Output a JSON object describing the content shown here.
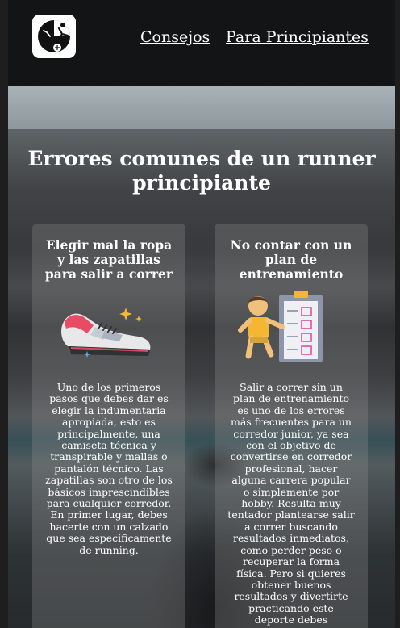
{
  "nav": {
    "links": [
      "Consejos",
      "Para Principiantes"
    ]
  },
  "logo": {
    "icon": "runner-logo-icon"
  },
  "hero": {
    "title": "Errores comunes de un runner principiante"
  },
  "cards": [
    {
      "title": "Elegir mal la ropa y las zapatillas para salir a correr",
      "icon": "running-shoe-icon",
      "body": "Uno de los primeros pasos que debes dar es elegir la indumentaria apropiada, esto es principalmente, una camiseta técnica y transpirable y mallas o pantalón técnico. Las zapatillas son otro de los básicos imprescindibles para cualquier corredor. En primer lugar, debes hacerte con un calzado que sea específicamente de running."
    },
    {
      "title": "No contar con un plan de entrenamiento",
      "icon": "training-plan-icon",
      "body": "Salir a correr sin un plan de entrenamiento es uno de los errores más frecuentes para un corredor junior, ya sea con el objetivo de convertirse en corredor profesional, hacer alguna carrera popular o simplemente por hobby. Resulta muy tentador plantearse salir a correr buscando resultados inmediatos, como perder peso o recuperar la forma física. Pero si quieres obtener buenos resultados y divertirte practicando este deporte debes desarrollar un plan de entrenamiento o"
    }
  ],
  "colors": {
    "header_bg": "#121416",
    "text": "#ffffff",
    "card_bg": "rgba(140,140,140,0.32)"
  }
}
